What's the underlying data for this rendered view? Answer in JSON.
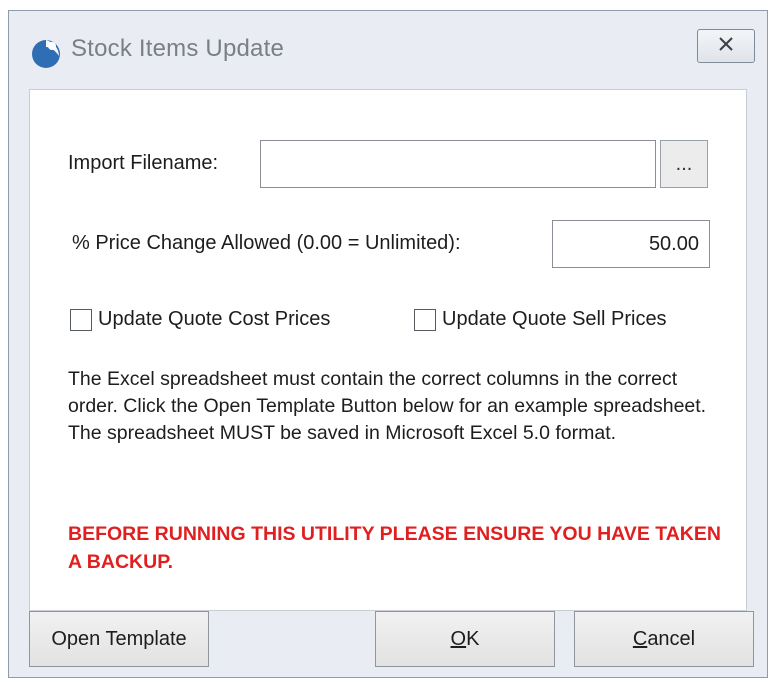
{
  "window": {
    "title": "Stock Items Update"
  },
  "form": {
    "import_filename_label": "Import Filename:",
    "import_filename_value": "",
    "browse_label": "...",
    "price_change_label": "% Price Change Allowed (0.00 = Unlimited):",
    "price_change_value": "50.00",
    "update_cost_label": "Update Quote Cost Prices",
    "update_cost_checked": false,
    "update_sell_label": "Update Quote Sell Prices",
    "update_sell_checked": false,
    "info_text": "The Excel spreadsheet must contain the correct columns in the correct order. Click the Open Template Button below for an example spreadsheet. The spreadsheet MUST be saved in Microsoft Excel 5.0 format.",
    "warning_text": "BEFORE RUNNING THIS UTILITY PLEASE ENSURE YOU HAVE TAKEN A BACKUP."
  },
  "buttons": {
    "open_template_label": "Open Template",
    "ok_mnemonic": "O",
    "ok_rest": "K",
    "cancel_mnemonic": "C",
    "cancel_rest": "ancel"
  },
  "icons": {
    "app": "app-logo-icon",
    "close": "close-icon"
  },
  "colors": {
    "warning": "#e02020",
    "app_icon": "#2f6db5"
  }
}
